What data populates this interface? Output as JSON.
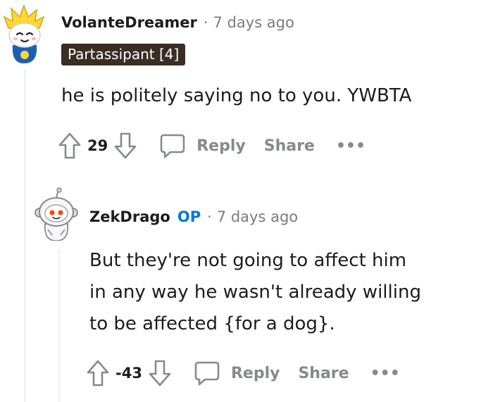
{
  "comments": [
    {
      "username": "VolanteDreamer",
      "separator": "·",
      "timestamp": "7 days ago",
      "flair": "Partassipant [4]",
      "body": [
        "he is politely saying no to you. YWBTA"
      ],
      "votes": "29",
      "reply_label": "Reply",
      "share_label": "Share",
      "more_label": "•••"
    },
    {
      "username": "ZekDrago",
      "op_tag": "OP",
      "separator": "·",
      "timestamp": "7 days ago",
      "body": [
        "But they're not going to affect him",
        "in any way he wasn't already willing",
        "to be affected {for a dog}."
      ],
      "votes": "-43",
      "reply_label": "Reply",
      "share_label": "Share",
      "more_label": "•••"
    }
  ],
  "colors": {
    "op_blue": "#0079d3",
    "flair_bg": "#3a2d23",
    "muted": "#878a8c",
    "thread_line": "#edeff1"
  },
  "icons": [
    "avatar-snoo-yellow-hair",
    "avatar-snoo-astronaut",
    "upvote-arrow-icon",
    "downvote-arrow-icon",
    "comment-bubble-icon",
    "more-options-icon"
  ]
}
